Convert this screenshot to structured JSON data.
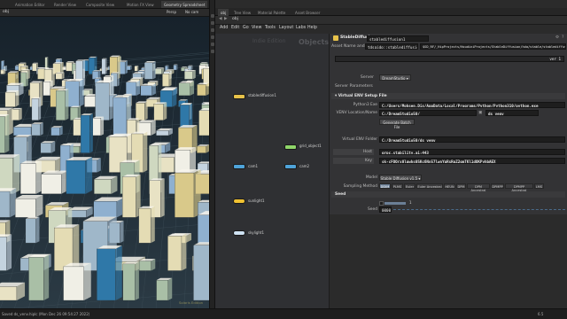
{
  "viewport": {
    "tabs": [
      "Animation Editor",
      "Render View",
      "Composite View",
      "Motion FX View",
      "Geometry Spreadsheet"
    ],
    "active_tab": 4,
    "path": "obj",
    "toolbar_right": "Persp",
    "camera": "No cam",
    "watermark": "Solaris Edition"
  },
  "network": {
    "tabs": [
      "obj",
      "Tree View",
      "Material Palette",
      "Asset Browser"
    ],
    "active_tab": 0,
    "path": "obj",
    "menu": [
      "Add",
      "Edit",
      "Go",
      "View",
      "Tools",
      "Layout",
      "Labs",
      "Help"
    ],
    "watermark_edition": "Indie Edition",
    "watermark_context": "Objects",
    "nodes": [
      {
        "name": "stablediffusion1",
        "label": "stablediffusion1",
        "color": "#e7c24a"
      },
      {
        "name": "grid_object1",
        "label": "grid_object1",
        "color": "#8fd66a"
      },
      {
        "name": "cam1",
        "label": "cam1",
        "color": "#4fa3d9"
      },
      {
        "name": "cam2",
        "label": "cam2",
        "color": "#4fa3d9"
      },
      {
        "name": "sunlight1",
        "label": "sunlight1",
        "color": "#f1c232"
      },
      {
        "name": "skylight1",
        "label": "skylight1",
        "color": "#cfe2f3"
      }
    ]
  },
  "params": {
    "node_type": "StableDiffusion",
    "node_name": "stablediffusion1",
    "asset_name_label": "Asset Name and Path",
    "asset_name_value": "tdsaido::stablediffusio...",
    "asset_path_value": "$SD_RF/_HipProjects/HoudiniProjects/StableDiffusion/hda/stable/stablediffusion.hda",
    "server_label": "Server",
    "server_value": "DreamStudio",
    "server_params_label": "Server Parameters",
    "venv_section": "Virtual ENV Setup File",
    "python_exe_label": "Python3 Exe",
    "python_exe_value": "C:/Users/Mohsen.Dis/AppData/Local/Programs/Python/Python310/python.exe",
    "venv_location_label": "VENV Location/Name",
    "venv_location_value": "C:/DreamStudio50/",
    "venv_name_value": "ds_venv",
    "generate_batch_label": "Generate Batch File",
    "venv_folder_label": "Virtual ENV Folder",
    "venv_folder_value": "C:/DreamStudio50/ds_venv",
    "host_label": "Host",
    "host_value": "grpc.stability.ai:443",
    "key_label": "Key",
    "key_value": "sk-cFOOrx0lqwhs0SKc6Nn57lwnYpRsRgZ2gmTKl1dOKPyhbAEX",
    "model_label": "Model",
    "model_value": "Stable Diffusion v1.5",
    "sampling_label": "Sampling Method",
    "samplers": [
      "DDIM",
      "PLMS",
      "Euler",
      "Euler Ancestral",
      "HEUN",
      "DPM",
      "DPM Ancestral",
      "DPMPP",
      "DPMPP Ancestral",
      "LMS"
    ],
    "active_sampler": 0,
    "seed_section": "Seed",
    "seed_label": "Seed",
    "seed_value": "0000",
    "scale_value": "1",
    "version_value": "ver 1"
  },
  "status": {
    "text": "Saved ds_venv.hiplc (Mon Dec 26 09:54:27 2022)",
    "frame": "6.5"
  }
}
